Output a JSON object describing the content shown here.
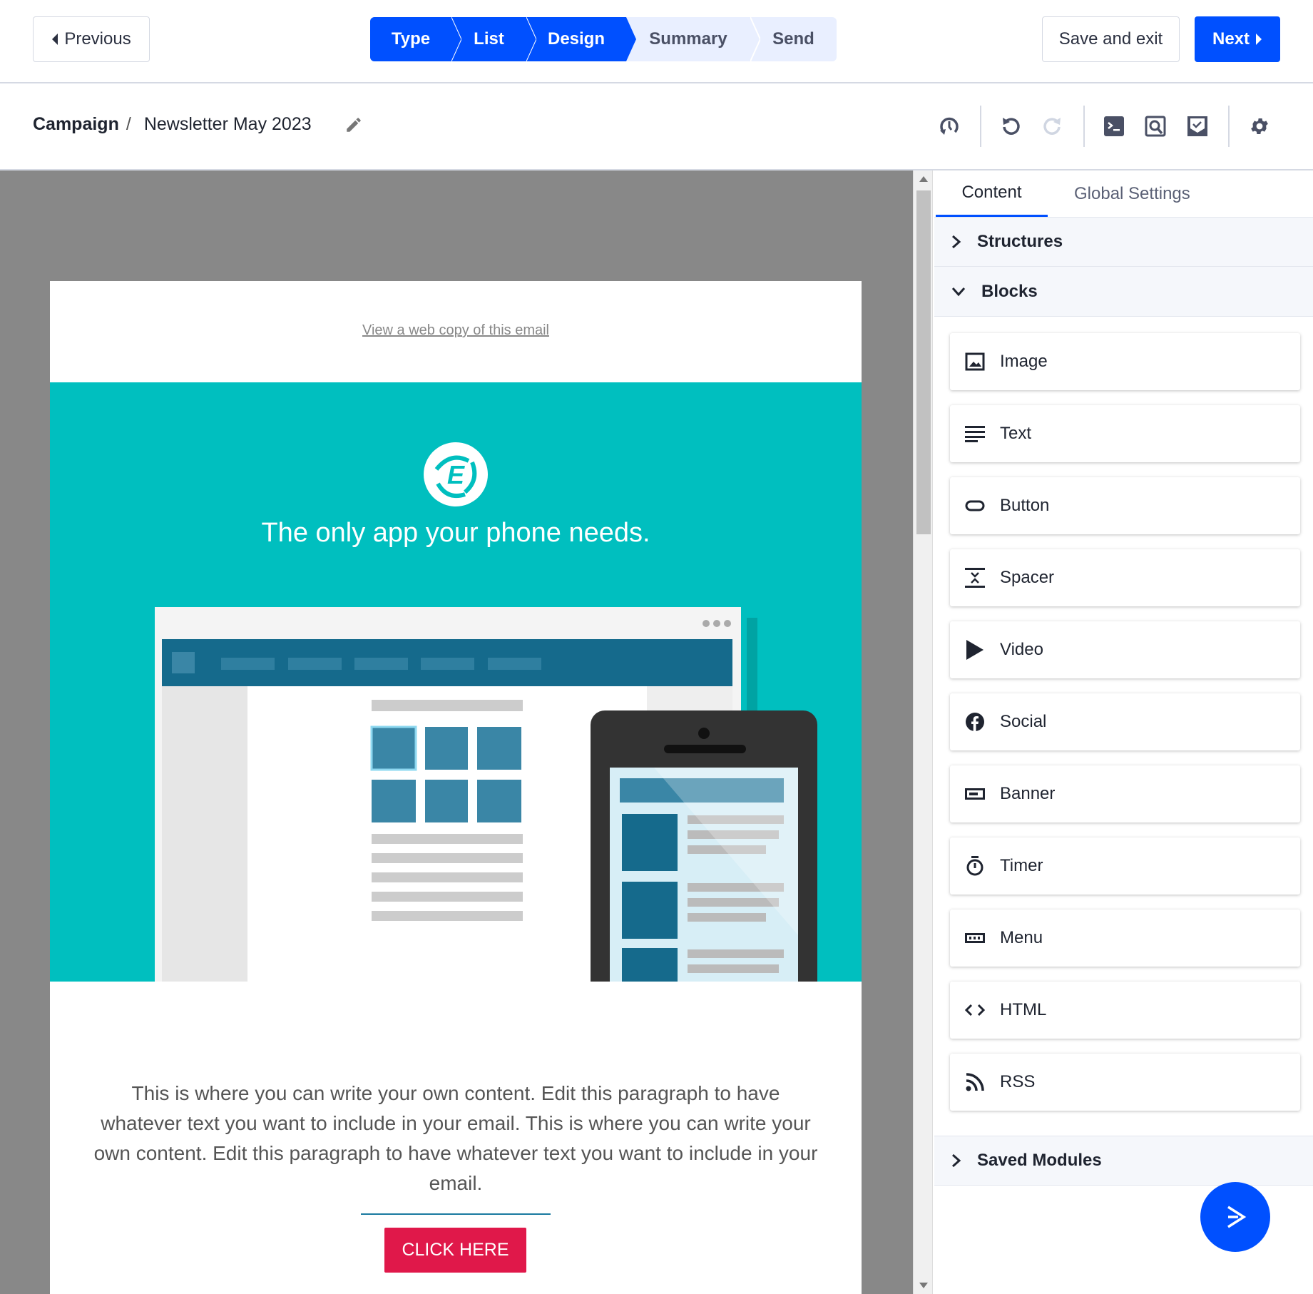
{
  "topbar": {
    "previous_label": "Previous",
    "save_exit_label": "Save and exit",
    "next_label": "Next",
    "steps": [
      {
        "label": "Type",
        "done": true
      },
      {
        "label": "List",
        "done": true
      },
      {
        "label": "Design",
        "done": true,
        "current": true
      },
      {
        "label": "Summary",
        "done": false
      },
      {
        "label": "Send",
        "done": false
      }
    ]
  },
  "breadcrumb": {
    "root": "Campaign",
    "separator": "/",
    "current": "Newsletter May 2023"
  },
  "toolbar": {
    "icons": [
      "history-icon",
      "undo-icon",
      "redo-icon",
      "code-icon",
      "preview-icon",
      "test-email-icon",
      "settings-icon"
    ]
  },
  "email": {
    "web_copy_link": "View a web copy of this email",
    "headline": "The only app your phone needs.",
    "logo_letter": "E",
    "paragraph": "This is where you can write your own content. Edit this paragraph to have whatever text you want to include in your email. This is where you can write your own content. Edit this paragraph to have whatever text you want to include in your email.",
    "button_label": "CLICK HERE",
    "colors": {
      "hero": "#00bfbf",
      "button": "#e0184a"
    }
  },
  "panel": {
    "tabs": [
      {
        "label": "Content",
        "active": true
      },
      {
        "label": "Global Settings",
        "active": false
      }
    ],
    "structures_label": "Structures",
    "blocks_label": "Blocks",
    "saved_modules_label": "Saved Modules",
    "blocks": [
      {
        "label": "Image",
        "icon": "image-icon"
      },
      {
        "label": "Text",
        "icon": "text-icon"
      },
      {
        "label": "Button",
        "icon": "button-icon"
      },
      {
        "label": "Spacer",
        "icon": "spacer-icon"
      },
      {
        "label": "Video",
        "icon": "video-icon"
      },
      {
        "label": "Social",
        "icon": "facebook-icon"
      },
      {
        "label": "Banner",
        "icon": "banner-icon"
      },
      {
        "label": "Timer",
        "icon": "timer-icon"
      },
      {
        "label": "Menu",
        "icon": "menu-icon"
      },
      {
        "label": "HTML",
        "icon": "code-icon"
      },
      {
        "label": "RSS",
        "icon": "rss-icon"
      }
    ]
  },
  "accent": "#0050ff"
}
